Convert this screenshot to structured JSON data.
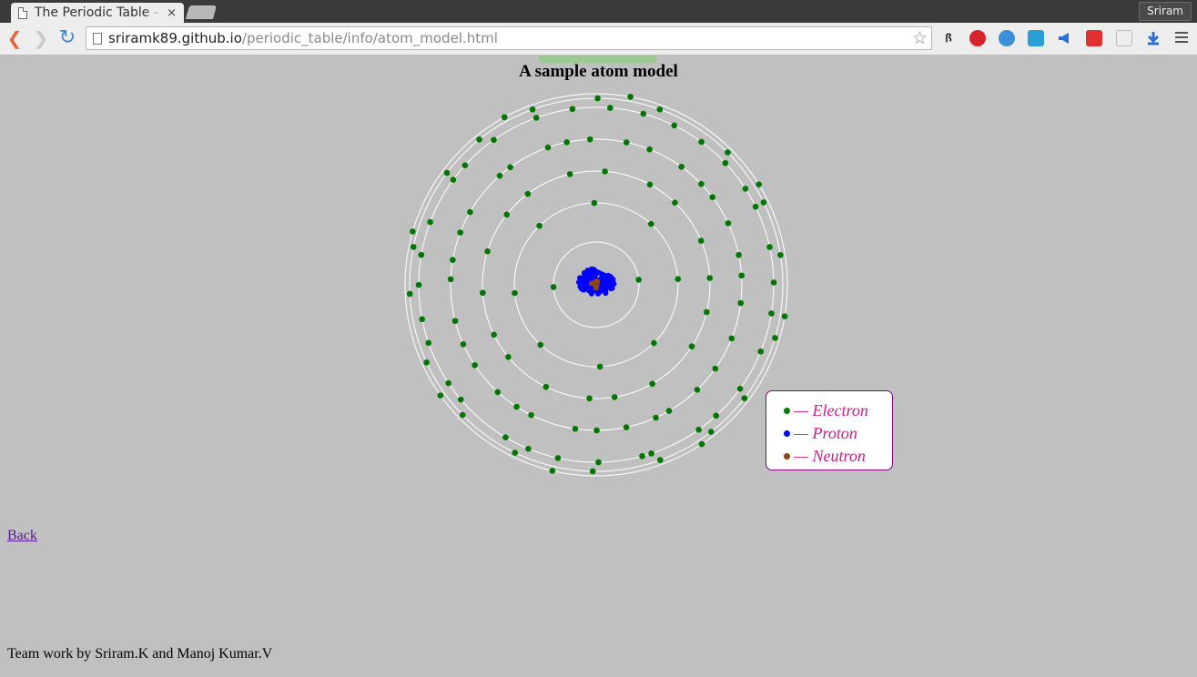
{
  "browser": {
    "tab_title": "The Periodic Table - A",
    "tab_close": "×",
    "profile_name": "Sriram",
    "url_host": "sriramk89.github.io",
    "url_path": "/periodic_table/info/atom_model.html",
    "nav": {
      "back": "❮",
      "forward": "❯",
      "reload": "↻",
      "star": "☆"
    }
  },
  "page": {
    "title": "A sample atom model",
    "back_link": "Back",
    "footer": "Team work by Sriram.K and Manoj Kumar.V"
  },
  "legend": {
    "items": [
      {
        "label": "— Electron",
        "color": "#008000"
      },
      {
        "label": "— Proton",
        "color": "#0000ff"
      },
      {
        "label": "— Neutron",
        "color": "#8b4513"
      }
    ],
    "text_color": "#d11a8a",
    "border_color": "#8b008b"
  },
  "atom": {
    "colors": {
      "electron": "#007700",
      "proton": "#0000ff",
      "neutron": "#8b4513",
      "orbit": "#ffffff"
    },
    "shell_electron_counts": [
      2,
      8,
      18,
      32,
      32,
      18,
      8
    ],
    "nucleus": {
      "protons": 118,
      "neutrons": 176
    }
  }
}
